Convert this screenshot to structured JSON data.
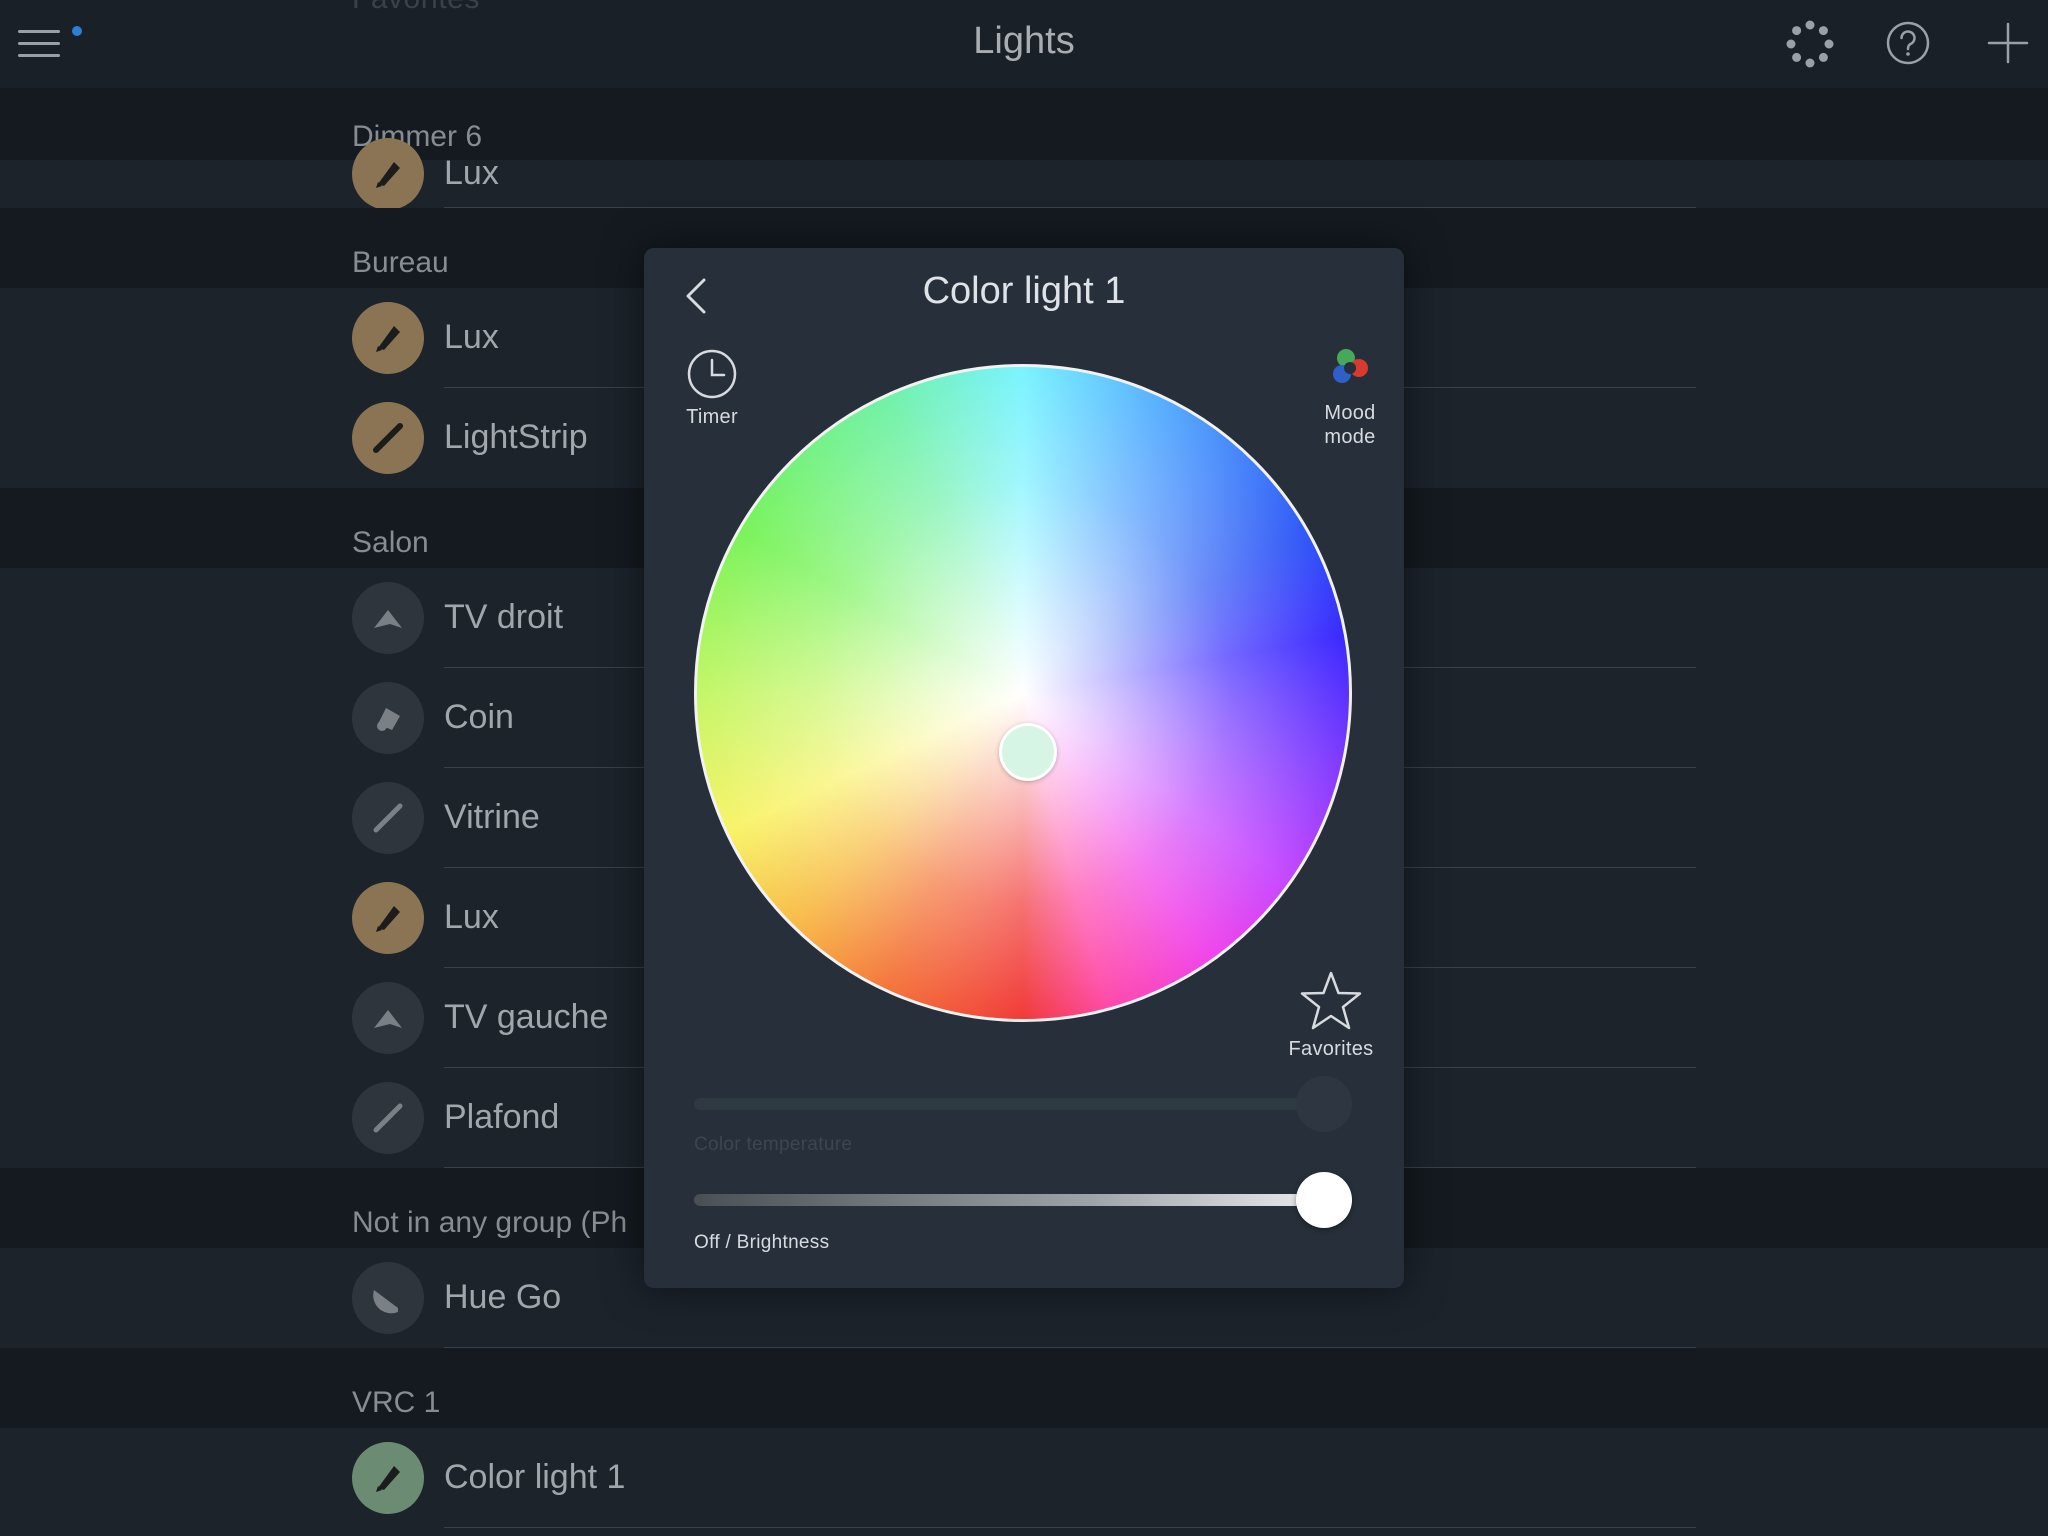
{
  "header": {
    "ghost_text": "Favorites",
    "title": "Lights"
  },
  "sections": [
    {
      "name": "Dimmer 6",
      "lights": [
        {
          "label": "Lux",
          "state": "on",
          "icon": "bulb-icon"
        }
      ]
    },
    {
      "name": "Bureau",
      "lights": [
        {
          "label": "Lux",
          "state": "on",
          "icon": "bulb-icon"
        },
        {
          "label": "LightStrip",
          "state": "on",
          "icon": "strip-icon"
        }
      ]
    },
    {
      "name": "Salon",
      "lights": [
        {
          "label": "TV droit",
          "state": "off",
          "icon": "spot-icon"
        },
        {
          "label": "Coin",
          "state": "off",
          "icon": "lamp-icon"
        },
        {
          "label": "Vitrine",
          "state": "off",
          "icon": "strip-icon"
        },
        {
          "label": "Lux",
          "state": "on",
          "icon": "bulb-icon"
        },
        {
          "label": "TV gauche",
          "state": "off",
          "icon": "spot-icon"
        },
        {
          "label": "Plafond",
          "state": "off",
          "icon": "strip-icon"
        }
      ]
    },
    {
      "name": "Not in any group (Ph",
      "lights": [
        {
          "label": "Hue Go",
          "state": "off",
          "icon": "hue-go-icon"
        }
      ]
    },
    {
      "name": "VRC 1",
      "lights": [
        {
          "label": "Color light 1",
          "state": "green",
          "icon": "bulb-icon"
        }
      ]
    }
  ],
  "dialog": {
    "title": "Color light 1",
    "timer_label": "Timer",
    "mood_label_line1": "Mood",
    "mood_label_line2": "mode",
    "favorites_label": "Favorites",
    "color_temperature_label": "Color temperature",
    "brightness_label": "Off / Brightness",
    "brightness_value": 1.0,
    "color_temperature_value": 1.0
  },
  "colors": {
    "accent": "#2d7fd4",
    "bulb_on": "#8a7454",
    "bulb_off": "#2f353c",
    "bulb_selected": "#6b8c72",
    "dialog_bg": "#27303a",
    "picker_color": "#d6f5e4"
  }
}
